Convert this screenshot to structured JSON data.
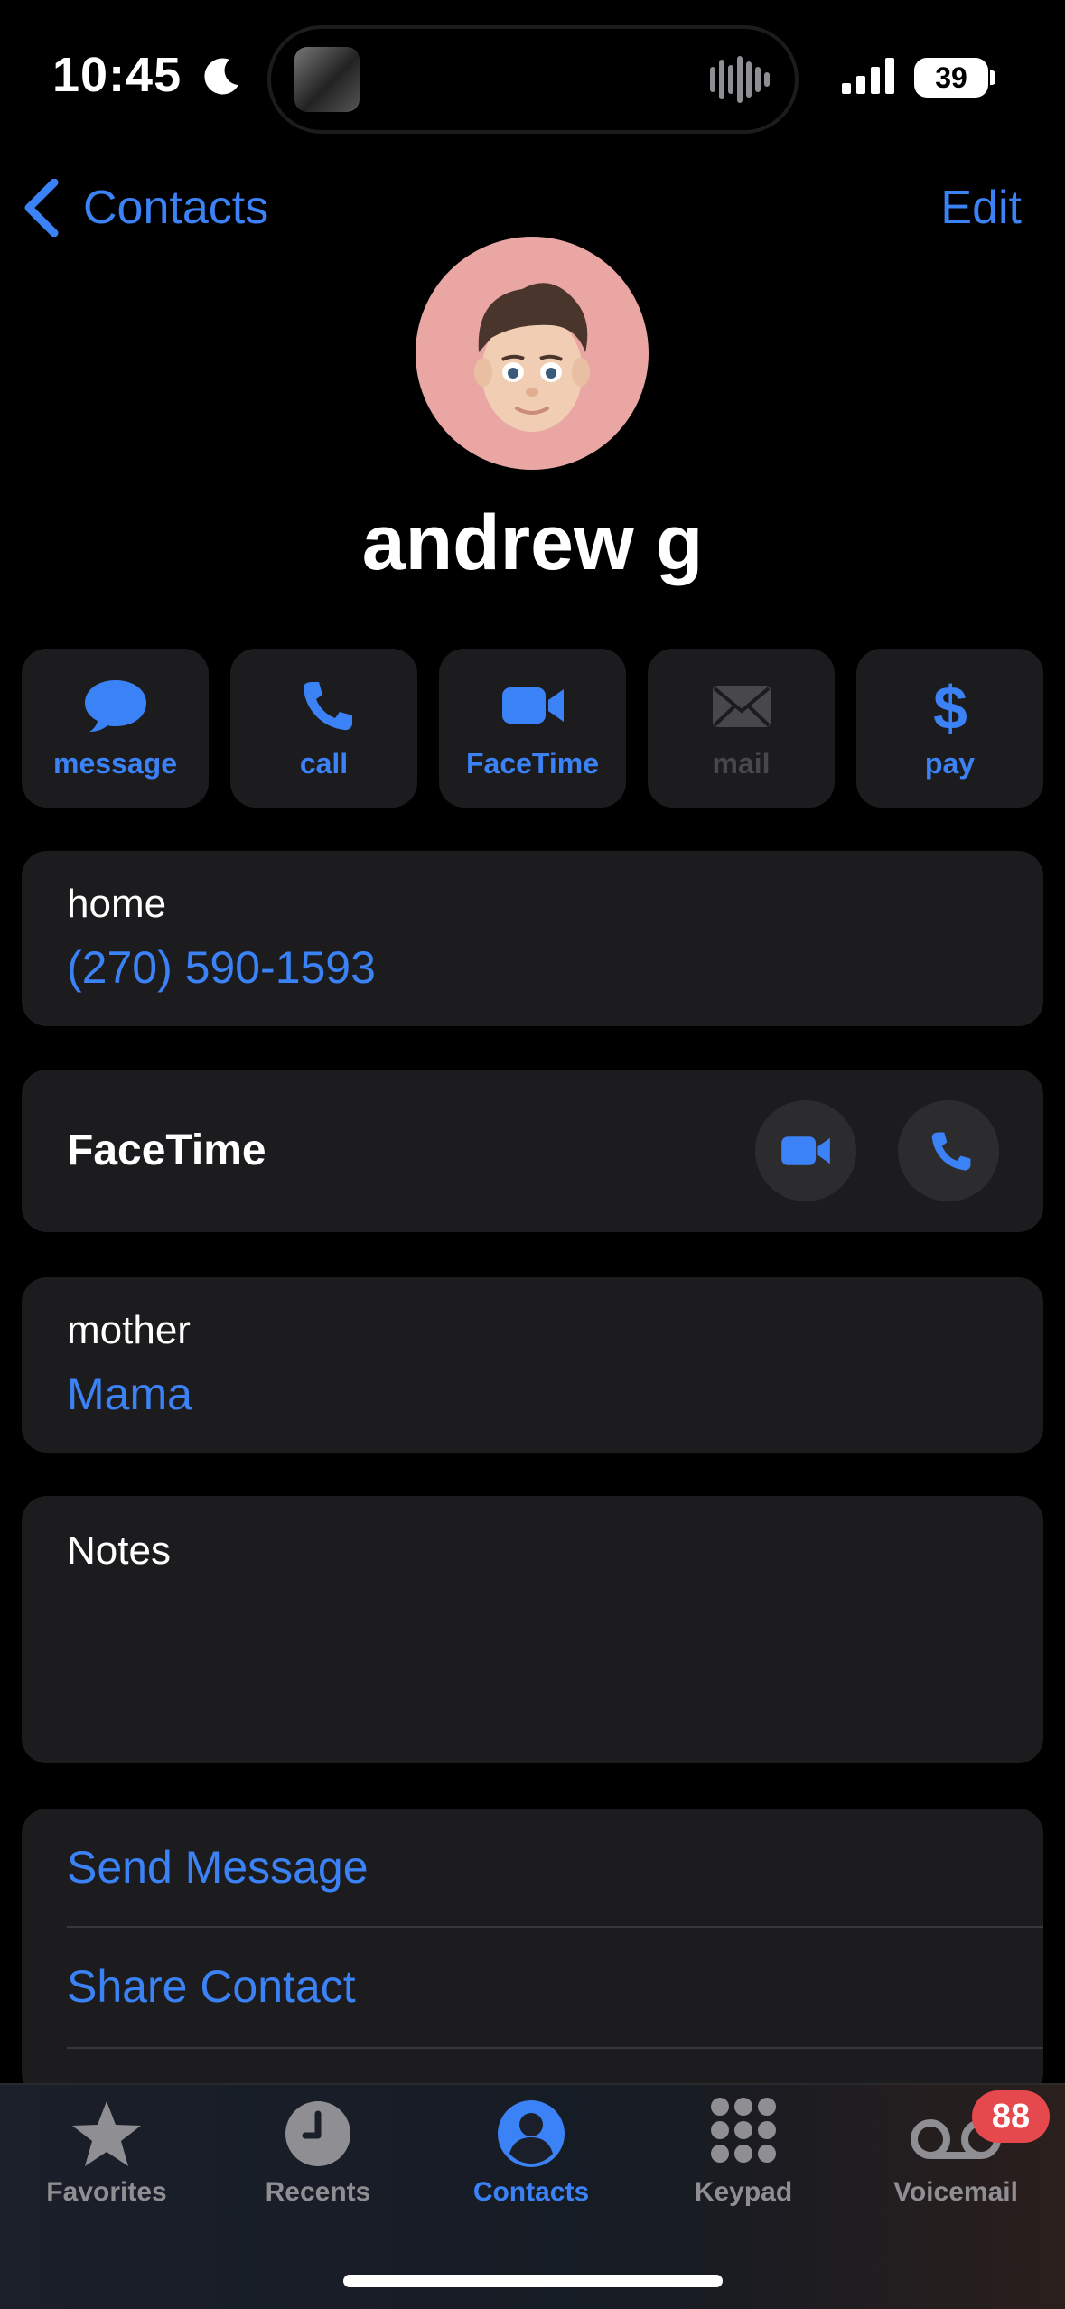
{
  "status_bar": {
    "time": "10:45",
    "battery": "39"
  },
  "nav": {
    "back_label": "Contacts",
    "edit_label": "Edit"
  },
  "contact": {
    "name": "andrew g"
  },
  "actions": [
    {
      "label": "message",
      "icon": "message-bubble-icon",
      "enabled": true
    },
    {
      "label": "call",
      "icon": "phone-icon",
      "enabled": true
    },
    {
      "label": "FaceTime",
      "icon": "video-camera-icon",
      "enabled": true
    },
    {
      "label": "mail",
      "icon": "envelope-icon",
      "enabled": false
    },
    {
      "label": "pay",
      "icon": "dollar-sign-icon",
      "enabled": true
    }
  ],
  "phone": {
    "label": "home",
    "number": "(270) 590-1593"
  },
  "facetime": {
    "label": "FaceTime"
  },
  "relation": {
    "label": "mother",
    "name": "Mama"
  },
  "notes": {
    "label": "Notes"
  },
  "links": {
    "send_message": "Send Message",
    "share_contact": "Share Contact"
  },
  "tabs": [
    {
      "label": "Favorites",
      "icon": "star-icon",
      "active": false
    },
    {
      "label": "Recents",
      "icon": "clock-icon",
      "active": false
    },
    {
      "label": "Contacts",
      "icon": "person-circle-icon",
      "active": true
    },
    {
      "label": "Keypad",
      "icon": "keypad-icon",
      "active": false
    },
    {
      "label": "Voicemail",
      "icon": "voicemail-icon",
      "active": false
    }
  ],
  "voicemail_badge": "88",
  "colors": {
    "accent": "#3b82f6",
    "card": "#1c1c1e",
    "badge": "#e5484d",
    "avatar_bg": "#e9a6a3"
  }
}
